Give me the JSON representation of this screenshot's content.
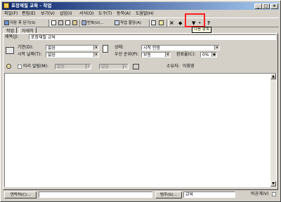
{
  "window": {
    "title": "포장재질 교육 - 작업",
    "controls": [
      "_",
      "□",
      "×"
    ]
  },
  "menubar": {
    "items": [
      "파일(F)",
      "편집(E)",
      "보기(V)",
      "삽입(I)",
      "서식(O)",
      "도구(T)",
      "동작(A)",
      "도움말(H)"
    ]
  },
  "toolbar": {
    "save_close": "저장 후 닫기(S)",
    "recurrence": "반복(U)...",
    "assign_task": "작업 할당(A)",
    "delete": "×",
    "prev": "◆",
    "next": "▼",
    "help": "?"
  },
  "tooltip": {
    "text": "다음 항목"
  },
  "tabs": [
    "작업",
    "자세히"
  ],
  "form": {
    "subject_label": "제목(J):",
    "subject_value": "포장재질 교육",
    "due_label": "기한(D):",
    "due_value": "없음",
    "start_label": "시작 날짜(T):",
    "start_value": "없음",
    "status_label": "상태:",
    "status_value": "시작 안함",
    "priority_label": "우선 순위(P):",
    "priority_value": "보통",
    "complete_label": "완료율(C):",
    "complete_value": "0%",
    "reminder_label": "미리 알림(M):",
    "reminder_date": "없음",
    "reminder_time": "없음",
    "owner_label": "소유자:",
    "owner_value": "이화영"
  },
  "bottom": {
    "contacts_button": "연락처(C)...",
    "contacts_value": "",
    "categories_button": "범주(G)...",
    "categories_value": "교육",
    "private_label": "비공개(V)"
  }
}
